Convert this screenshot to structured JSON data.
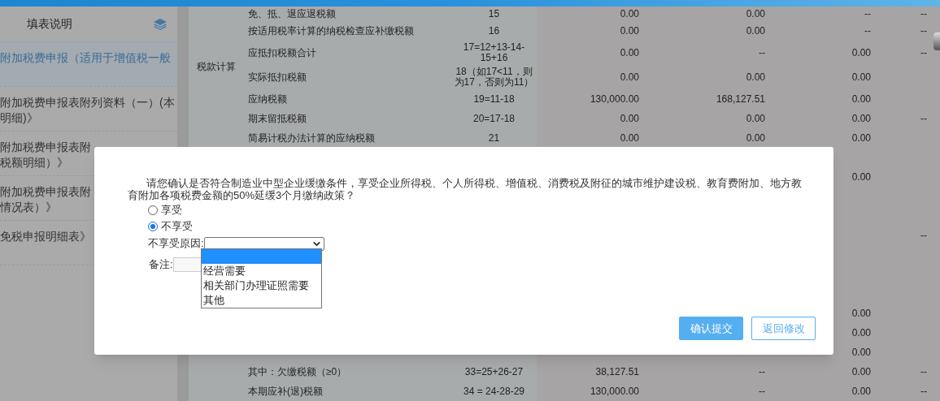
{
  "sidebar": {
    "title": "填表说明",
    "items": [
      {
        "lines": [
          "附加税费申报（适用于增值税一般"
        ],
        "selected": true
      },
      {
        "lines": [
          "附加税费申报表附列资料（一）(本",
          "明细)》"
        ],
        "selected": false
      },
      {
        "lines": [
          "附加税费申报表附",
          "税额明细）》"
        ],
        "selected": false
      },
      {
        "lines": [
          "附加税费申报表附",
          "情况表）》"
        ],
        "selected": false
      },
      {
        "lines": [
          "免税申报明细表》"
        ],
        "selected": false
      }
    ]
  },
  "table": {
    "group_label": "税款计算",
    "top_rows": [
      {
        "cells": [
          "免、抵、退应退税额",
          "15",
          "0.00",
          "0.00",
          "--",
          "--"
        ]
      },
      {
        "cells": [
          "按适用税率计算的纳税检查应补缴税额",
          "16",
          "0.00",
          "0.00",
          "--",
          "--"
        ]
      },
      {
        "cells": [
          "应抵扣税额合计",
          "17=12+13-14-15+16",
          "0.00",
          "--",
          "0.00",
          "--"
        ]
      },
      {
        "cells": [
          "实际抵扣税额",
          "18（如17<11，则为17，否则为11）",
          "0.00",
          "0.00",
          "0.00",
          null
        ]
      },
      {
        "cells": [
          "应纳税额",
          "19=11-18",
          "130,000.00",
          "168,127.51",
          "0.00",
          null
        ]
      },
      {
        "cells": [
          "期末留抵税额",
          "20=17-18",
          "0.00",
          "0.00",
          "0.00",
          "--"
        ]
      },
      {
        "cells": [
          "简易计税办法计算的应纳税额",
          "21",
          "0.00",
          "0.00",
          "0.00",
          null
        ]
      }
    ],
    "hidden_rows": [
      {
        "cells": [
          null,
          null
        ]
      },
      {
        "cells": [
          "0.00",
          null
        ]
      },
      {
        "cells": [
          null,
          null
        ]
      },
      {
        "cells": [
          null,
          null
        ]
      },
      {
        "cells": [
          null,
          "--"
        ]
      },
      {
        "cells": [
          null,
          null
        ]
      },
      {
        "cells": [
          null,
          null
        ]
      },
      {
        "cells": [
          null,
          null
        ]
      },
      {
        "cells": [
          "0.00",
          null
        ]
      },
      {
        "cells": [
          "0.00",
          null
        ]
      },
      {
        "cells": [
          "0.00",
          null
        ]
      }
    ],
    "bottom_rows": [
      {
        "cells": [
          "其中：欠缴税额（≥0）",
          "33=25+26-27",
          "38,127.51",
          "--",
          "0.00",
          "--"
        ]
      },
      {
        "cells": [
          "本期应补(退)税额",
          "34 = 24-28-29",
          "130,000.00",
          "--",
          "0.00",
          "--"
        ]
      }
    ]
  },
  "dialog": {
    "message": "请您确认是否符合制造业中型企业缓缴条件，享受企业所得税、个人所得税、增值税、消费税及附征的城市维护建设税、教育费附加、地方教育附加各项税费金额的50%延缓3个月缴纳政策？",
    "options": [
      {
        "label": "享受",
        "selected": false
      },
      {
        "label": "不享受",
        "selected": true
      }
    ],
    "reason_label": "不享受原因:",
    "reason_options": [
      {
        "selected": true
      },
      {
        "label": "经营需要",
        "selected": false
      },
      {
        "label": "相关部门办理证照需要",
        "selected": false
      },
      {
        "label": "其他",
        "selected": false
      }
    ],
    "remark_label": "备注:",
    "buttons": [
      {
        "label": "确认提交",
        "kind": "primary"
      },
      {
        "label": "返回修改",
        "kind": "secondary"
      }
    ]
  }
}
